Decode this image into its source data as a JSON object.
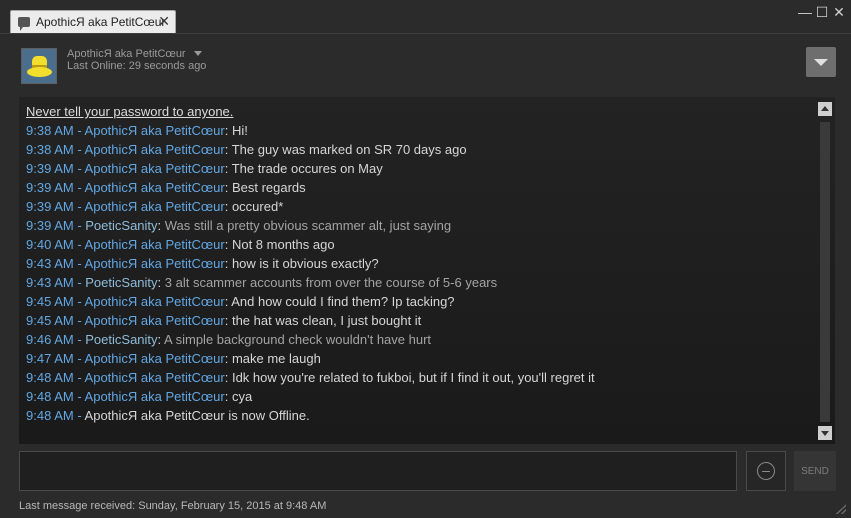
{
  "tab": {
    "title": "ApothicЯ aka PetitCœur",
    "close": "✕"
  },
  "window": {
    "minimize": "—",
    "maximize": "☐",
    "close": "✕"
  },
  "friend": {
    "name": "ApothicЯ aka PetitCœur",
    "status": "Last Online: 29 seconds ago"
  },
  "chat": {
    "warning": "Never tell your password to anyone.",
    "messages": [
      {
        "time": "9:38 AM",
        "sender": "ApothicЯ aka PetitCœur",
        "kind": "friend",
        "text": "Hi!"
      },
      {
        "time": "9:38 AM",
        "sender": "ApothicЯ aka PetitCœur",
        "kind": "friend",
        "text": "The guy was marked on SR 70 days ago"
      },
      {
        "time": "9:39 AM",
        "sender": "ApothicЯ aka PetitCœur",
        "kind": "friend",
        "text": "The trade occures on May"
      },
      {
        "time": "9:39 AM",
        "sender": "ApothicЯ aka PetitCœur",
        "kind": "friend",
        "text": "Best regards"
      },
      {
        "time": "9:39 AM",
        "sender": "ApothicЯ aka PetitCœur",
        "kind": "friend",
        "text": "occured*"
      },
      {
        "time": "9:39 AM",
        "sender": "PoeticSanity",
        "kind": "self",
        "text": "Was still a pretty obvious scammer alt, just saying"
      },
      {
        "time": "9:40 AM",
        "sender": "ApothicЯ aka PetitCœur",
        "kind": "friend",
        "text": "Not 8 months ago"
      },
      {
        "time": "9:43 AM",
        "sender": "ApothicЯ aka PetitCœur",
        "kind": "friend",
        "text": "how is it obvious exactly?"
      },
      {
        "time": "9:43 AM",
        "sender": "PoeticSanity",
        "kind": "self",
        "text": "3 alt scammer accounts from over the course of 5-6 years"
      },
      {
        "time": "9:45 AM",
        "sender": "ApothicЯ aka PetitCœur",
        "kind": "friend",
        "text": "And how could I find them? Ip tacking?"
      },
      {
        "time": "9:45 AM",
        "sender": "ApothicЯ aka PetitCœur",
        "kind": "friend",
        "text": "the hat was clean, I just bought it"
      },
      {
        "time": "9:46 AM",
        "sender": "PoeticSanity",
        "kind": "self",
        "text": "A simple background check wouldn't have hurt"
      },
      {
        "time": "9:47 AM",
        "sender": "ApothicЯ aka PetitCœur",
        "kind": "friend",
        "text": "make me laugh"
      },
      {
        "time": "9:48 AM",
        "sender": "ApothicЯ aka PetitCœur",
        "kind": "friend",
        "text": "Idk how you're related to fukboi, but if I find it out, you'll regret it"
      },
      {
        "time": "9:48 AM",
        "sender": "ApothicЯ aka PetitCœur",
        "kind": "friend",
        "text": "cya"
      }
    ],
    "offline": {
      "time": "9:48 AM",
      "text": "ApothicЯ aka PetitCœur is now Offline."
    }
  },
  "input": {
    "placeholder": ""
  },
  "send": {
    "label": "SEND"
  },
  "footer": {
    "text": "Last message received: Sunday, February 15, 2015 at 9:48 AM"
  },
  "colors": {
    "time": "#62a7e3",
    "friend_name": "#62a7e3",
    "self_name": "#8fbcdb",
    "background": "#2b2b2b"
  }
}
